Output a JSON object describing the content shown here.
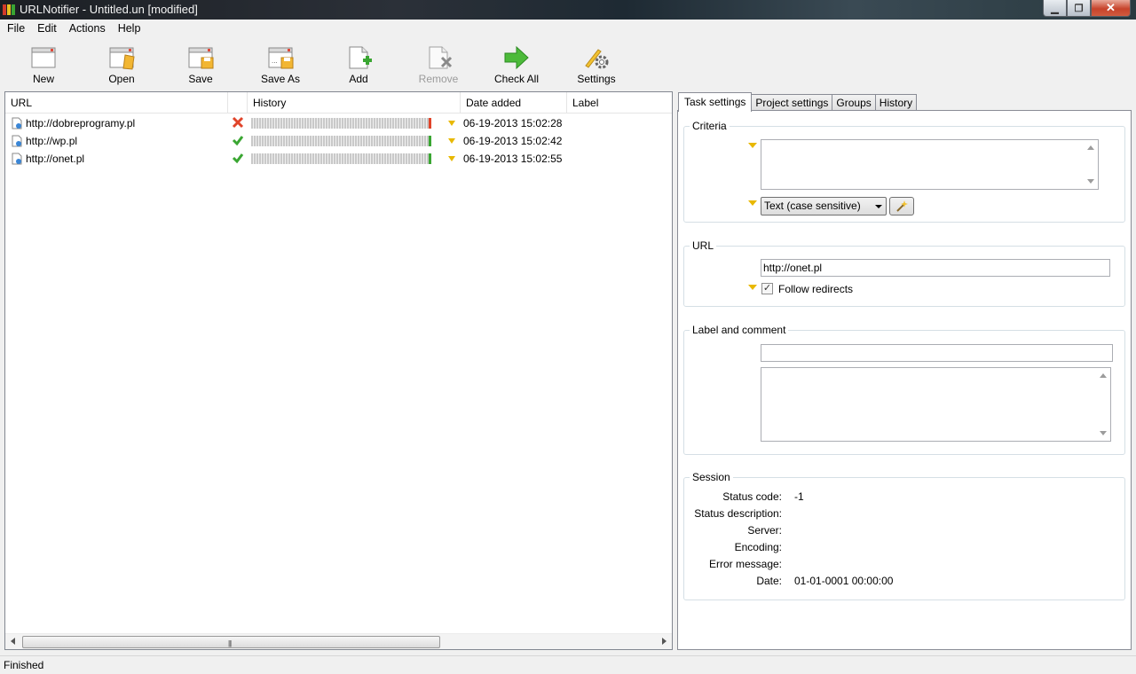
{
  "window": {
    "title": "URLNotifier - Untitled.un [modified]"
  },
  "menu": [
    "File",
    "Edit",
    "Actions",
    "Help"
  ],
  "toolbar": {
    "new": "New",
    "open": "Open",
    "save": "Save",
    "save_as": "Save As",
    "add": "Add",
    "remove": "Remove",
    "check_all": "Check All",
    "settings": "Settings"
  },
  "list": {
    "columns": {
      "url": "URL",
      "history": "History",
      "date_added": "Date added",
      "label": "Label"
    },
    "rows": [
      {
        "url": "http://dobreprogramy.pl",
        "status": "error",
        "date": "06-19-2013 15:02:28",
        "label": ""
      },
      {
        "url": "http://wp.pl",
        "status": "ok",
        "date": "06-19-2013 15:02:42",
        "label": ""
      },
      {
        "url": "http://onet.pl",
        "status": "ok",
        "date": "06-19-2013 15:02:55",
        "label": ""
      }
    ]
  },
  "tabs": [
    "Task settings",
    "Project settings",
    "Groups",
    "History"
  ],
  "active_tab": "Task settings",
  "criteria": {
    "title": "Criteria",
    "text": "",
    "mode": "Text (case sensitive)"
  },
  "url_group": {
    "title": "URL",
    "value": "http://onet.pl",
    "follow_redirects_label": "Follow redirects",
    "follow_redirects": true
  },
  "label_comment": {
    "title": "Label and comment",
    "label": "",
    "comment": ""
  },
  "session": {
    "title": "Session",
    "status_code_label": "Status code:",
    "status_code": "-1",
    "status_description_label": "Status description:",
    "status_description": "",
    "server_label": "Server:",
    "server": "",
    "encoding_label": "Encoding:",
    "encoding": "",
    "error_message_label": "Error message:",
    "error_message": "",
    "date_label": "Date:",
    "date": "01-01-0001 00:00:00"
  },
  "statusbar": {
    "text": "Finished"
  },
  "colors": {
    "error": "#e0442a",
    "ok": "#3aa632",
    "marker": "#e8b800"
  }
}
